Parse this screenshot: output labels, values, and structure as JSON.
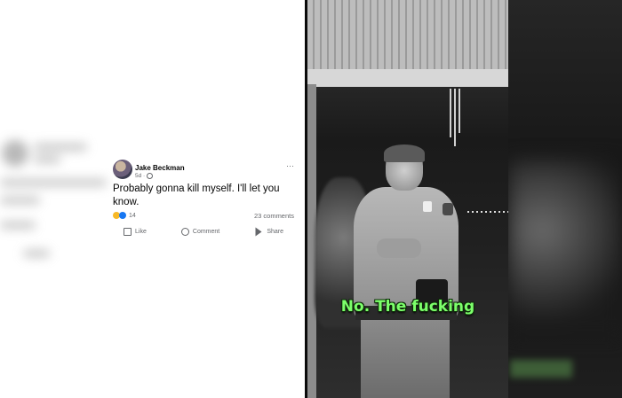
{
  "post": {
    "author": "Jake Beckman",
    "time": "5d ·",
    "body": "Probably gonna kill myself. I'll let you know.",
    "reaction_count": "14",
    "comments": "23 comments",
    "actions": {
      "like": "Like",
      "comment": "Comment",
      "share": "Share"
    },
    "more": "···"
  },
  "video": {
    "caption": "No. The fucking"
  },
  "colors": {
    "caption": "#7cff6b",
    "facebook_blue": "#1877f2"
  }
}
